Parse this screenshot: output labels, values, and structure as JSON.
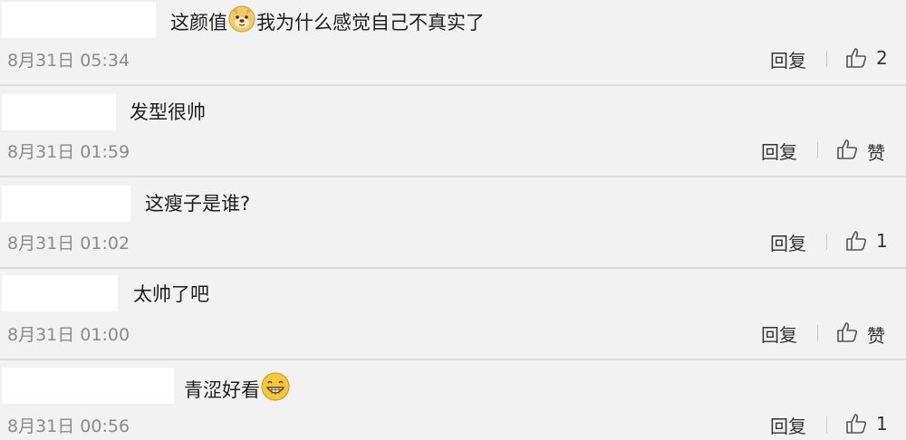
{
  "labels": {
    "reply": "回复",
    "like_zero": "赞"
  },
  "comments": [
    {
      "text_before": "这颜值",
      "emoji": "doge-emoji",
      "text_after": "我为什么感觉自己不真实了",
      "time": "8月31日 05:34",
      "likes": "2"
    },
    {
      "text_before": "发型很帅",
      "emoji": "",
      "text_after": "",
      "time": "8月31日 01:59",
      "likes": "赞"
    },
    {
      "text_before": "这瘦子是谁?",
      "emoji": "",
      "text_after": "",
      "time": "8月31日 01:02",
      "likes": "1"
    },
    {
      "text_before": "太帅了吧",
      "emoji": "",
      "text_after": "",
      "time": "8月31日 01:00",
      "likes": "赞"
    },
    {
      "text_before": "青涩好看",
      "emoji": "grin-emoji",
      "text_after": "",
      "time": "8月31日 00:56",
      "likes": "1"
    }
  ]
}
